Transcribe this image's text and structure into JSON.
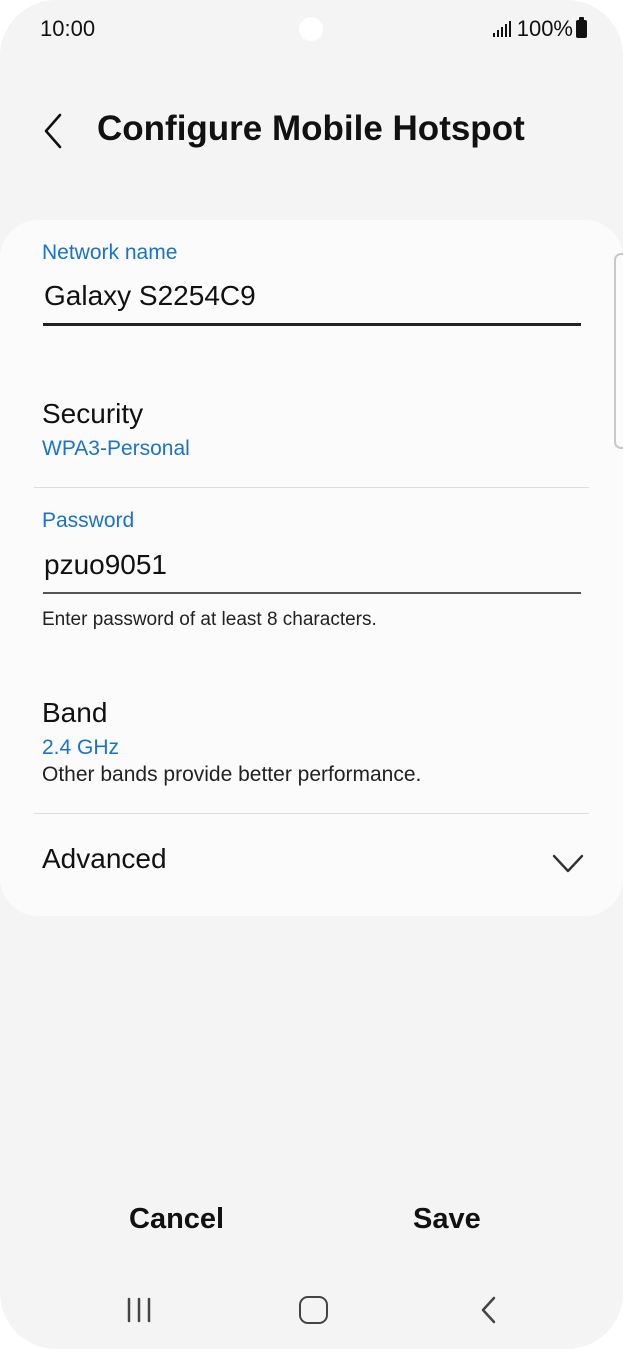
{
  "status_bar": {
    "time": "10:00",
    "battery": "100%"
  },
  "header": {
    "title": "Configure Mobile Hotspot"
  },
  "network_name": {
    "label": "Network name",
    "value": "Galaxy S2254C9"
  },
  "security": {
    "title": "Security",
    "value": "WPA3-Personal"
  },
  "password": {
    "label": "Password",
    "value": "pzuo9051",
    "hint": "Enter password of at least 8 characters."
  },
  "band": {
    "title": "Band",
    "value": "2.4 GHz",
    "note": "Other bands provide better performance."
  },
  "advanced": {
    "title": "Advanced"
  },
  "actions": {
    "cancel": "Cancel",
    "save": "Save"
  },
  "colors": {
    "accent": "#1a73c9",
    "background": "#f4f4f4",
    "card": "#fbfbfb"
  },
  "icons": {
    "back": "chevron-left-icon",
    "expand": "chevron-down-icon",
    "nav_recent": "recent-apps-icon",
    "nav_home": "home-icon",
    "nav_back": "nav-back-icon",
    "signal": "signal-icon",
    "battery": "battery-icon"
  }
}
